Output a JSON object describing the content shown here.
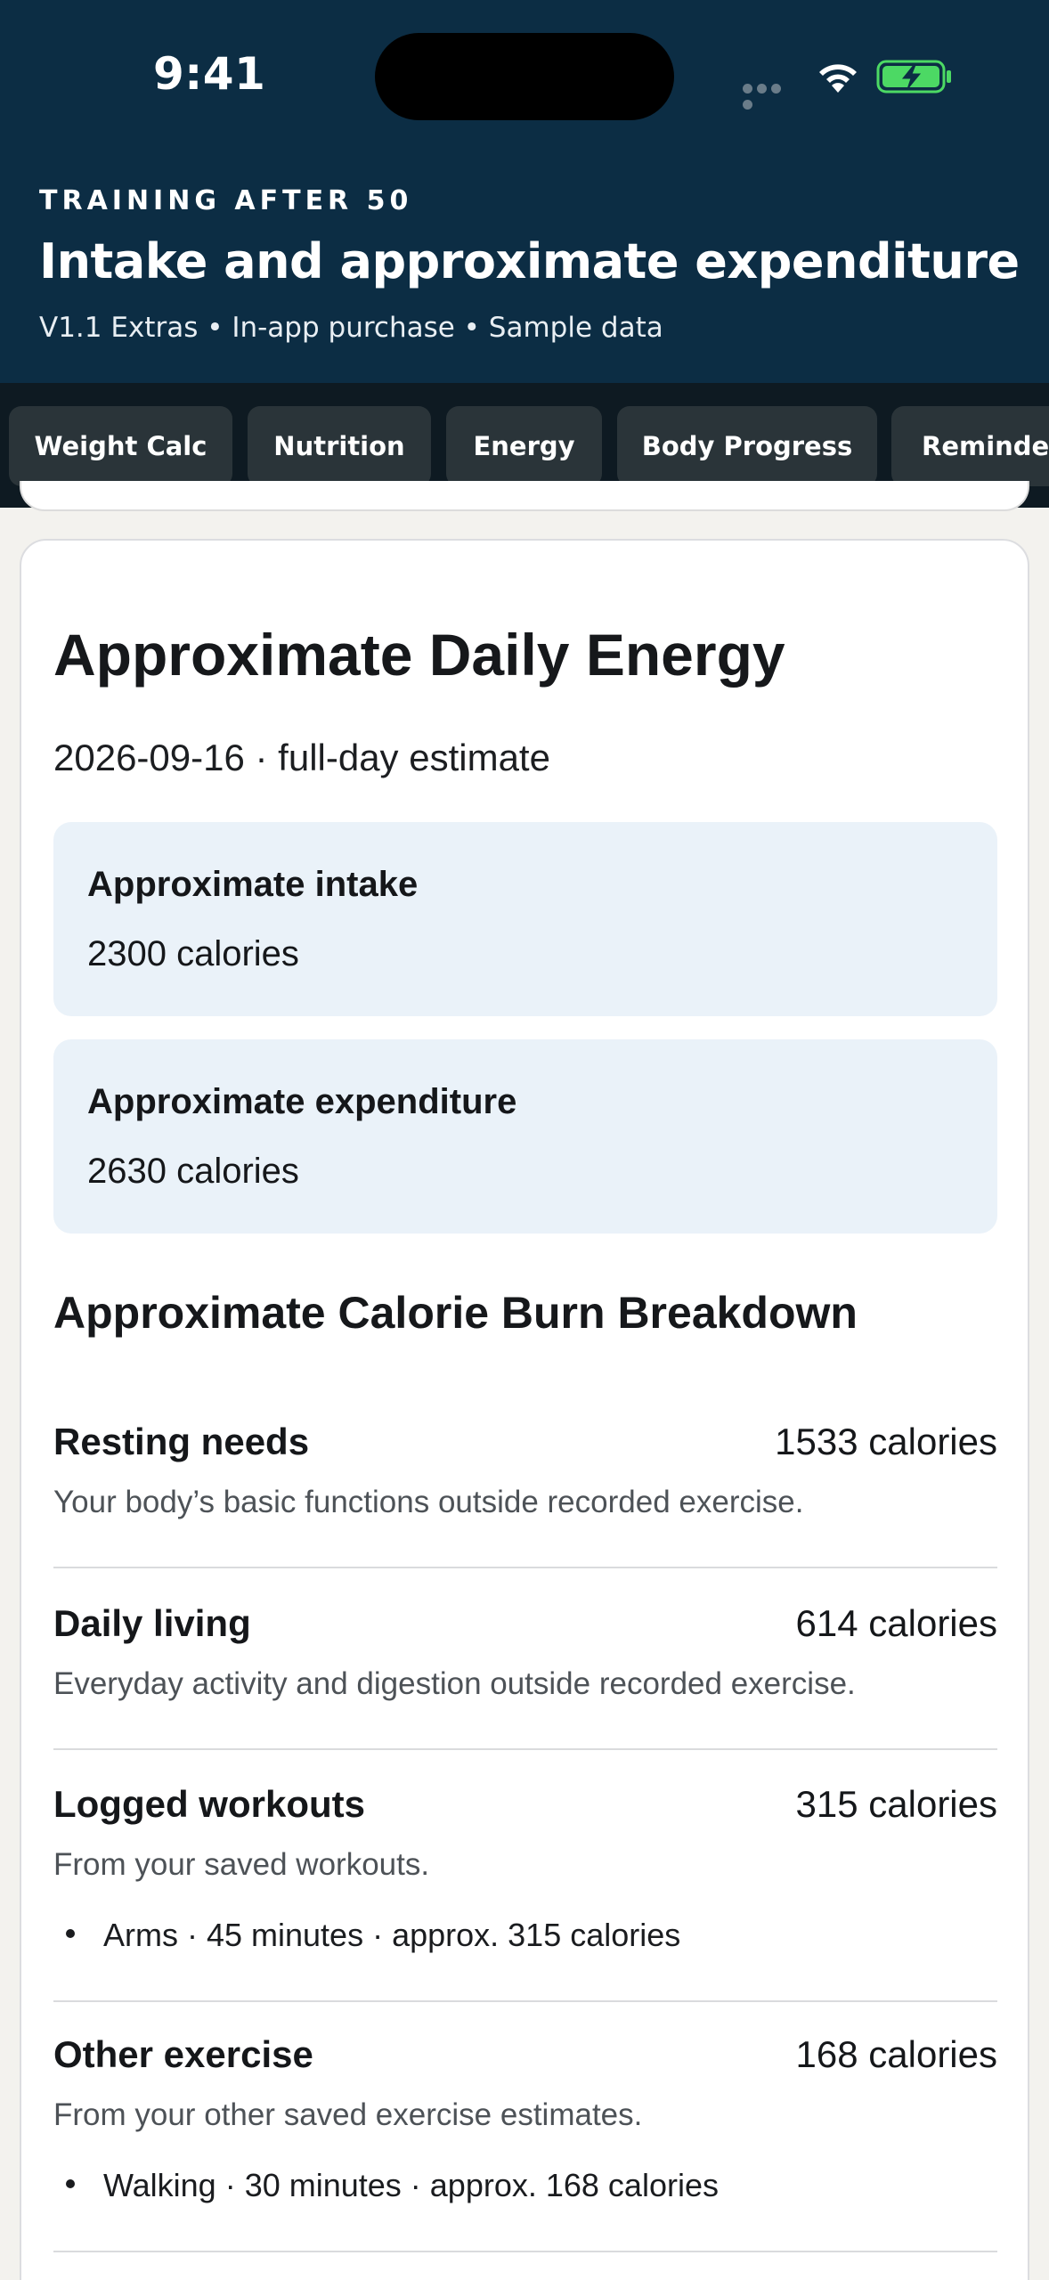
{
  "status_bar": {
    "time": "9:41"
  },
  "header": {
    "eyebrow": "TRAINING AFTER 50",
    "title": "Intake and approximate expenditure",
    "subtitle": "V1.1 Extras • In-app purchase • Sample data"
  },
  "tabs": [
    {
      "label": "Weight Calc"
    },
    {
      "label": "Nutrition"
    },
    {
      "label": "Energy"
    },
    {
      "label": "Body Progress"
    },
    {
      "label": "Reminders"
    }
  ],
  "card": {
    "title": "Approximate Daily Energy",
    "date_line": "2026-09-16 · full-day estimate",
    "intake": {
      "label": "Approximate intake",
      "value": "2300 calories"
    },
    "expenditure": {
      "label": "Approximate expenditure",
      "value": "2630 calories"
    },
    "breakdown_heading": "Approximate Calorie Burn Breakdown",
    "breakdown": [
      {
        "label": "Resting needs",
        "value": "1533 calories",
        "description": "Your body’s basic functions outside recorded exercise.",
        "bullet": ""
      },
      {
        "label": "Daily living",
        "value": "614 calories",
        "description": "Everyday activity and digestion outside recorded exercise.",
        "bullet": ""
      },
      {
        "label": "Logged workouts",
        "value": "315 calories",
        "description": "From your saved workouts.",
        "bullet": "Arms · 45 minutes · approx. 315 calories"
      },
      {
        "label": "Other exercise",
        "value": "168 calories",
        "description": "From your other saved exercise estimates.",
        "bullet": "Walking · 30 minutes · approx. 168 calories"
      }
    ]
  },
  "colors": {
    "header_bg": "#0c2d44",
    "tab_bar_bg": "#0e1a22",
    "tab_bg": "#2a3439",
    "stat_box_bg": "#eaf2f9",
    "battery_green": "#4cd964"
  }
}
